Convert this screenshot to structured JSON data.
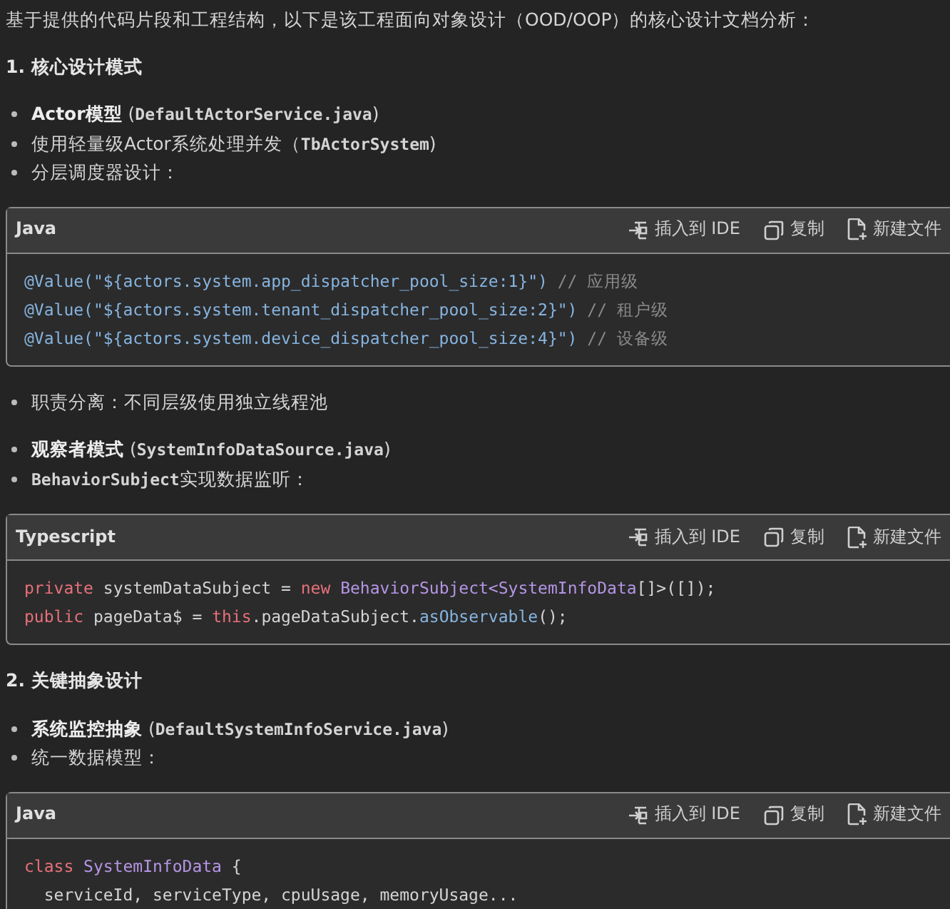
{
  "blocks": [
    {
      "kind": "paragraph",
      "text": "基于提供的代码片段和工程结构，以下是该工程面向对象设计（OOD/OOP）的核心设计文档分析："
    },
    {
      "kind": "heading",
      "text": "1. 核心设计模式"
    },
    {
      "kind": "bullets",
      "items": [
        [
          {
            "kind": "bold",
            "text": "Actor模型"
          },
          {
            "kind": "plain",
            "text": " ("
          },
          {
            "kind": "code",
            "text": "DefaultActorService.java"
          },
          {
            "kind": "plain",
            "text": ")"
          }
        ],
        [
          {
            "kind": "plain",
            "text": "使用轻量级Actor系统处理并发（"
          },
          {
            "kind": "code",
            "text": "TbActorSystem"
          },
          {
            "kind": "plain",
            "text": ")"
          }
        ],
        [
          {
            "kind": "plain",
            "text": "分层调度器设计："
          }
        ]
      ]
    },
    {
      "kind": "code",
      "language": "Java",
      "actions": [
        {
          "kind": "insert",
          "label": "插入到 IDE"
        },
        {
          "kind": "copy",
          "label": "复制"
        },
        {
          "kind": "newfile",
          "label": "新建文件"
        }
      ],
      "lines": [
        [
          {
            "kind": "annotation",
            "text": "@Value(\"${actors.system.app_dispatcher_pool_size:1}\")"
          },
          {
            "kind": "comment",
            "text": " // 应用级"
          }
        ],
        [
          {
            "kind": "annotation",
            "text": "@Value(\"${actors.system.tenant_dispatcher_pool_size:2}\")"
          },
          {
            "kind": "comment",
            "text": " // 租户级"
          }
        ],
        [
          {
            "kind": "annotation",
            "text": "@Value(\"${actors.system.device_dispatcher_pool_size:4}\")"
          },
          {
            "kind": "comment",
            "text": " // 设备级"
          }
        ]
      ]
    },
    {
      "kind": "bullets",
      "items": [
        [
          {
            "kind": "plain",
            "text": "职责分离：不同层级使用独立线程池"
          }
        ]
      ]
    },
    {
      "kind": "bullets",
      "items": [
        [
          {
            "kind": "bold",
            "text": "观察者模式"
          },
          {
            "kind": "plain",
            "text": " ("
          },
          {
            "kind": "code",
            "text": "SystemInfoDataSource.java"
          },
          {
            "kind": "plain",
            "text": ")"
          }
        ],
        [
          {
            "kind": "code",
            "text": "BehaviorSubject"
          },
          {
            "kind": "plain",
            "text": "实现数据监听："
          }
        ]
      ]
    },
    {
      "kind": "code",
      "language": "Typescript",
      "actions": [
        {
          "kind": "insert",
          "label": "插入到 IDE"
        },
        {
          "kind": "copy",
          "label": "复制"
        },
        {
          "kind": "newfile",
          "label": "新建文件"
        }
      ],
      "lines": [
        [
          {
            "kind": "keyword",
            "text": "private"
          },
          {
            "kind": "plain",
            "text": " systemDataSubject = "
          },
          {
            "kind": "keyword",
            "text": "new"
          },
          {
            "kind": "type",
            "text": " BehaviorSubject<SystemInfoData"
          },
          {
            "kind": "plain",
            "text": "[]>([]);"
          }
        ],
        [
          {
            "kind": "keyword",
            "text": "public"
          },
          {
            "kind": "plain",
            "text": " pageData$ = "
          },
          {
            "kind": "keyword",
            "text": "this"
          },
          {
            "kind": "plain",
            "text": ".pageDataSubject."
          },
          {
            "kind": "method",
            "text": "asObservable"
          },
          {
            "kind": "plain",
            "text": "();"
          }
        ]
      ]
    },
    {
      "kind": "heading",
      "text": "2. 关键抽象设计"
    },
    {
      "kind": "bullets",
      "items": [
        [
          {
            "kind": "bold",
            "text": "系统监控抽象"
          },
          {
            "kind": "plain",
            "text": " ("
          },
          {
            "kind": "code",
            "text": "DefaultSystemInfoService.java"
          },
          {
            "kind": "plain",
            "text": ")"
          }
        ],
        [
          {
            "kind": "plain",
            "text": "统一数据模型："
          }
        ]
      ]
    },
    {
      "kind": "code",
      "language": "Java",
      "actions": [
        {
          "kind": "insert",
          "label": "插入到 IDE"
        },
        {
          "kind": "copy",
          "label": "复制"
        },
        {
          "kind": "newfile",
          "label": "新建文件"
        }
      ],
      "lines": [
        [
          {
            "kind": "keyword",
            "text": "class"
          },
          {
            "kind": "type",
            "text": " SystemInfoData"
          },
          {
            "kind": "plain",
            "text": " {"
          }
        ],
        [
          {
            "kind": "plain",
            "text": "  serviceId, serviceType, cpuUsage, memoryUsage..."
          }
        ]
      ]
    }
  ]
}
